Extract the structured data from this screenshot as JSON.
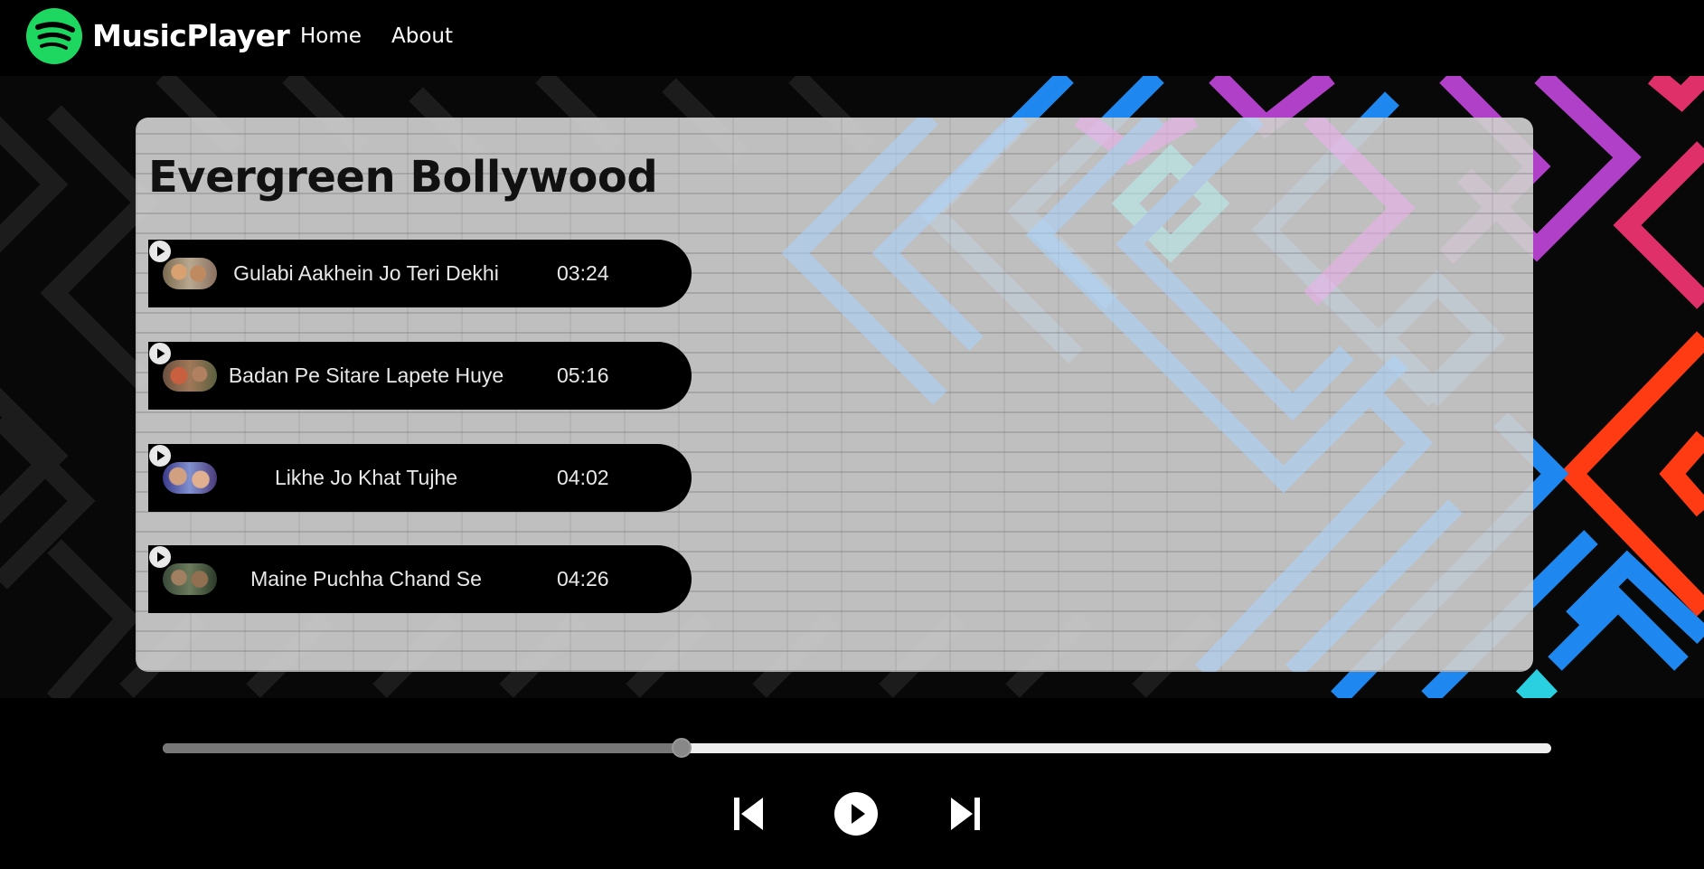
{
  "nav": {
    "brand": "MusicPlayer",
    "links": [
      "Home",
      "About"
    ],
    "brand_color": "#1ed760"
  },
  "playlist": {
    "title": "Evergreen Bollywood",
    "songs": [
      {
        "name": "Gulabi Aakhein Jo Teri Dekhi",
        "duration": "03:24",
        "icon": "play-circle-icon"
      },
      {
        "name": "Badan Pe Sitare Lapete Huye",
        "duration": "05:16",
        "icon": "play-circle-icon"
      },
      {
        "name": "Likhe Jo Khat Tujhe",
        "duration": "04:02",
        "icon": "play-circle-icon"
      },
      {
        "name": "Maine Puchha Chand Se",
        "duration": "04:26",
        "icon": "play-circle-icon"
      }
    ]
  },
  "player": {
    "progress_fraction": 0.374,
    "controls": [
      "previous-icon",
      "play-icon",
      "next-icon"
    ]
  },
  "colors": {
    "background": "#000000",
    "card": "#cdcdcd",
    "song_row": "#000000",
    "accent_blue": "#1e88f0",
    "accent_purple": "#b040c8",
    "accent_red": "#ff3b14",
    "accent_pink": "#e0306a"
  }
}
